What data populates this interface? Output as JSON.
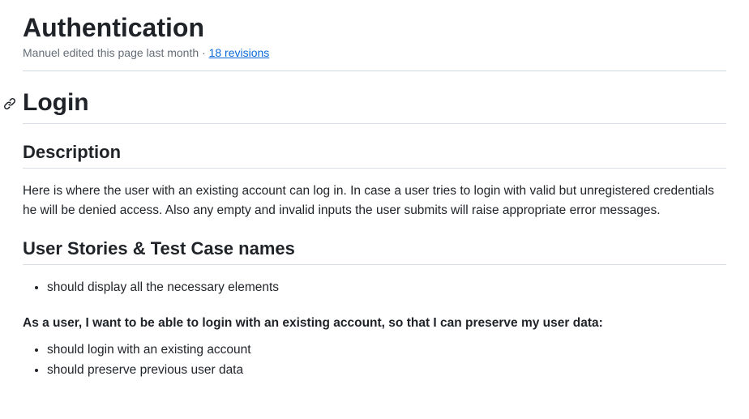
{
  "page": {
    "title": "Authentication",
    "meta_prefix": "Manuel edited this page last month · ",
    "revisions_link": "18 revisions"
  },
  "content": {
    "h1": "Login",
    "description_heading": "Description",
    "description_text": "Here is where the user with an existing account can log in. In case a user tries to login with valid but unregistered credentials he will be denied access. Also any empty and invalid inputs the user submits will raise appropriate error messages.",
    "stories_heading": "User Stories & Test Case names",
    "list1": {
      "item0": "should display all the necessary elements"
    },
    "story1_heading": "As a user, I want to be able to login with an existing account, so that I can preserve my user data:",
    "list2": {
      "item0": "should login with an existing account",
      "item1": "should preserve previous user data"
    }
  }
}
